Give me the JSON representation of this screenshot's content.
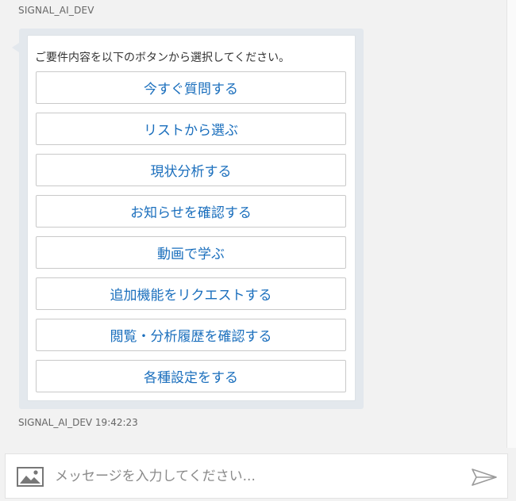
{
  "chat": {
    "sender": "SIGNAL_AI_DEV",
    "prompt": "ご要件内容を以下のボタンから選択してください。",
    "options": [
      "今すぐ質問する",
      "リストから選ぶ",
      "現状分析する",
      "お知らせを確認する",
      "動画で学ぶ",
      "追加機能をリクエストする",
      "閲覧・分析履歴を確認する",
      "各種設定をする"
    ],
    "timestamp": "SIGNAL_AI_DEV 19:42:23"
  },
  "composer": {
    "placeholder": "メッセージを入力してください...",
    "image_icon": "image-icon",
    "send_icon": "send-icon"
  },
  "colors": {
    "link": "#1b6fbd",
    "bubble": "#e3e8ed"
  }
}
